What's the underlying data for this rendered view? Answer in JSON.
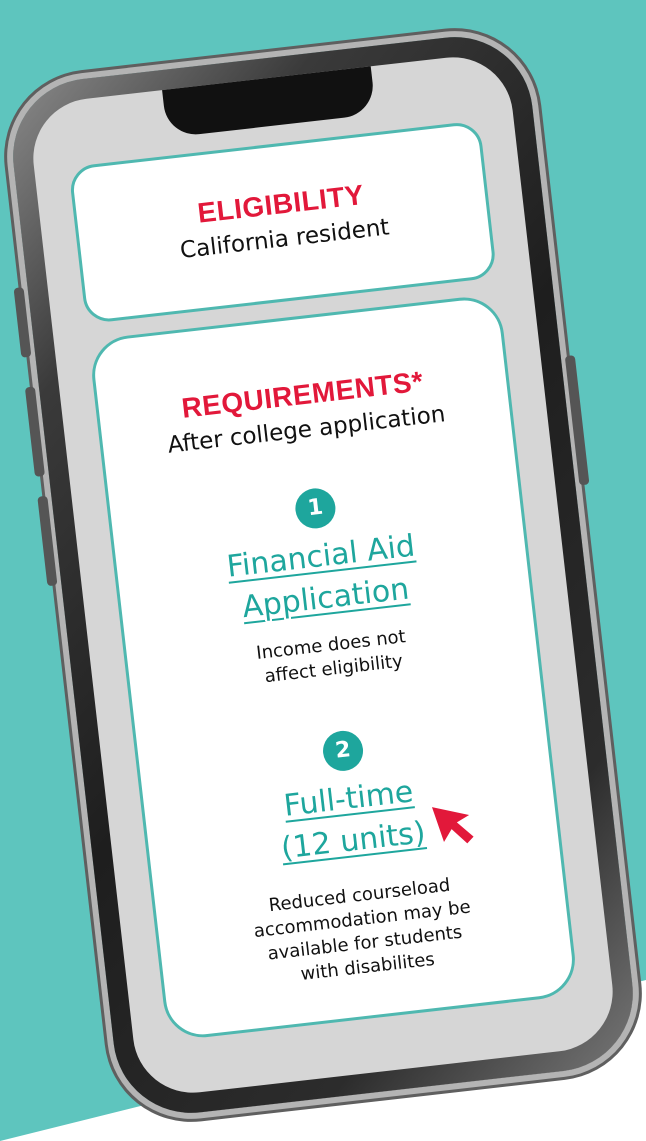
{
  "eligibility": {
    "heading": "ELIGIBILITY",
    "subheading": "California resident"
  },
  "requirements": {
    "heading": "REQUIREMENTS*",
    "subheading": "After college application",
    "steps": [
      {
        "number": "1",
        "link_line1": "Financial Aid",
        "link_line2": "Application",
        "note_line1": "Income does not",
        "note_line2": "affect eligibility"
      },
      {
        "number": "2",
        "link_line1": "Full-time",
        "link_line2": "(12 units)",
        "note_line1": "Reduced courseload",
        "note_line2": "accommodation may be",
        "note_line3": "available for students",
        "note_line4": "with disabilites"
      }
    ]
  },
  "colors": {
    "background": "#5ec5be",
    "heading_red": "#e2183a",
    "teal_accent": "#1ea69d",
    "card_border": "#4fb8b0",
    "cursor": "#e2183a"
  },
  "icons": {
    "cursor": "pointer-cursor-icon"
  }
}
